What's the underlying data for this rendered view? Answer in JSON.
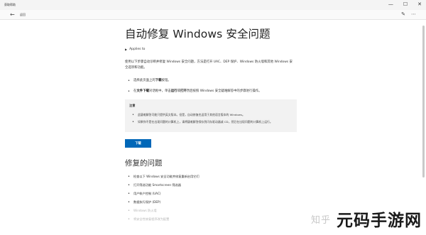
{
  "window": {
    "title": "获取帮助",
    "controls": {
      "minimize": "—",
      "maximize": "☐",
      "close": "✕"
    }
  },
  "nav": {
    "back_icon": "←",
    "label": "返回",
    "edit_icon": "✎",
    "more_icon": "⋯"
  },
  "article": {
    "title": "自动修复 Windows 安全问题",
    "applies_to": "Applies to",
    "intro": "使用以下步骤自动诊断并修复 Windows 安全问题，方法是打开 UAC、DEP 保护、Windows 防火墙和其他 Windows 安全选项和功能。",
    "steps": [
      {
        "pre": "选择此页面上的",
        "bold": "下载",
        "post": "按钮。"
      },
      {
        "pre": "在",
        "bold": "文件下载",
        "mid": "对话框中，单击",
        "bold2": "运行",
        "or": "或",
        "bold3": "打开",
        "post": "然后按照 Windows 安全疑难解答中的步骤进行操作。"
      }
    ],
    "note": {
      "title": "注意",
      "items": [
        "此疑难解答可能只提供英文版本。但是，自动修复也适用于其他语言版本的 Windows。",
        "如果你不是在出现问题的计算机上，请将疑难解答保存到闪存驱动器或 CD，然后在出现问题的计算机上运行。"
      ]
    },
    "download_button": "下载",
    "issues_heading": "修复的问题",
    "issues": [
      "检查以下 Windows 安全功能并修复重新启用它们",
      "打开筛选功能 Smartscreen 筛选器",
      "用户帐户控制 (UAC)",
      "数据执行保护 (DEP)",
      "Windows 防火墙",
      "将安全性修复程序改为配置"
    ]
  },
  "watermark": {
    "zhihu": "知乎",
    "brand": "元码手游网"
  }
}
